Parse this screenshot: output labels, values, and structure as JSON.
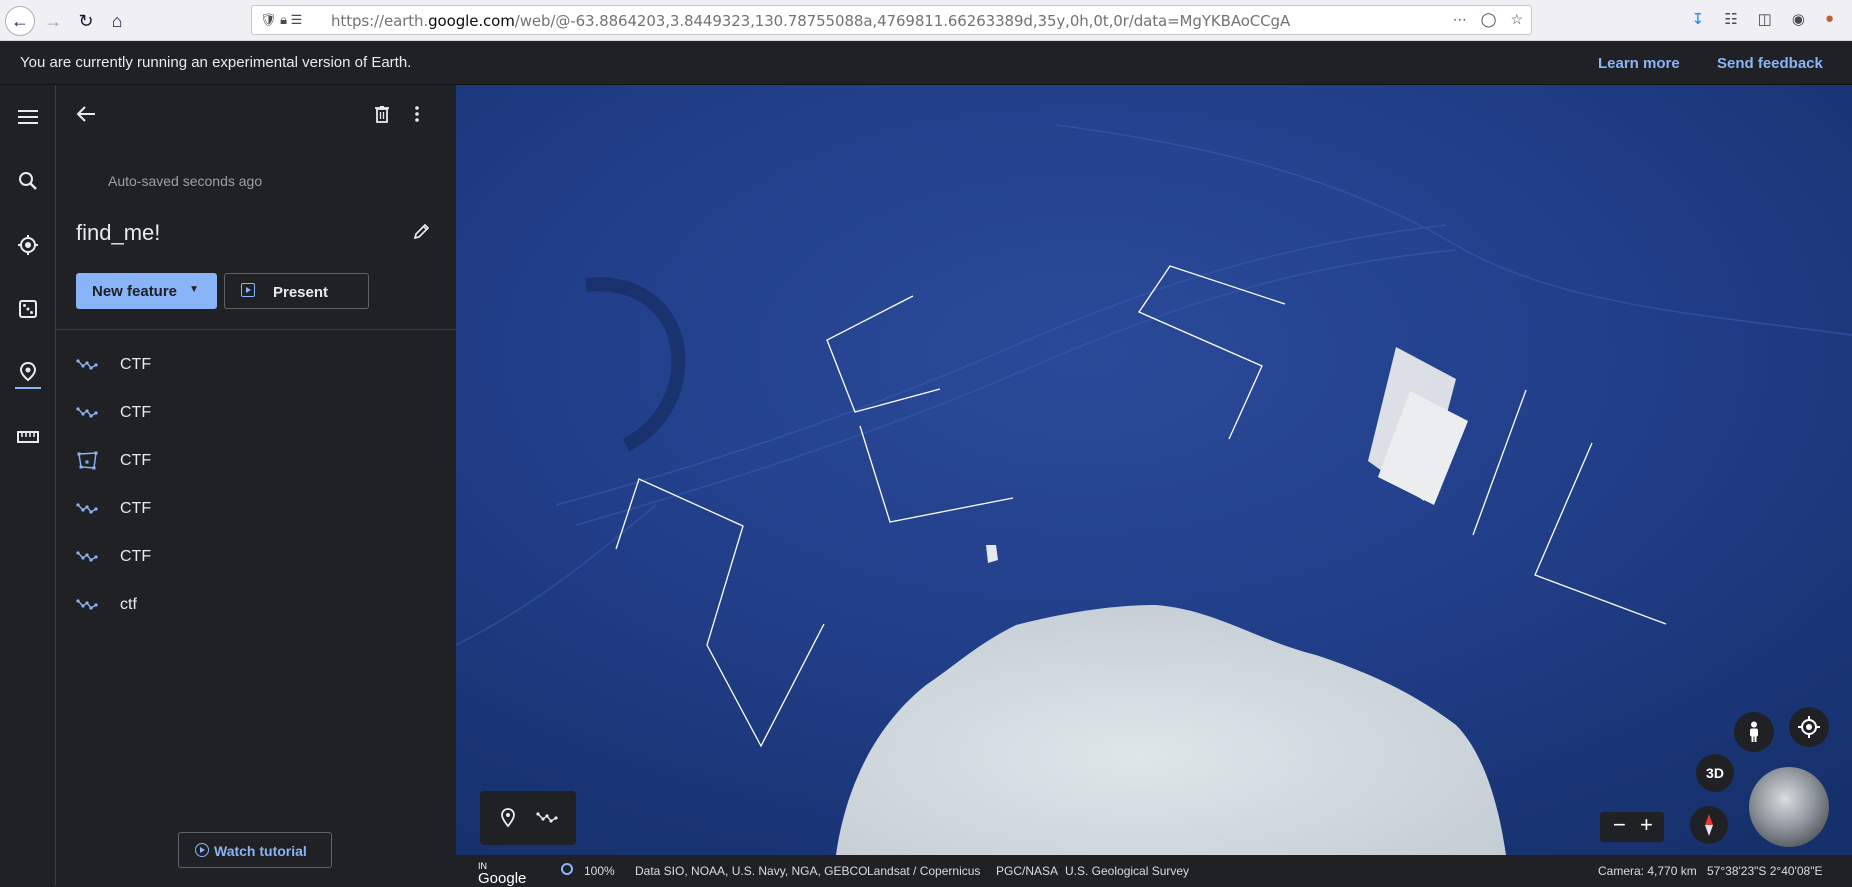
{
  "browser": {
    "url_prefix": "https://earth.",
    "url_host": "google.com",
    "url_rest": "/web/@-63.8864203,3.8449323,130.78755088a,4769811.66263389d,35y,0h,0t,0r/data=MgYKBAoCCgA"
  },
  "banner": {
    "message": "You are currently running an experimental version of Earth.",
    "learn_more": "Learn more",
    "send_feedback": "Send feedback"
  },
  "panel": {
    "autosave": "Auto-saved seconds ago",
    "title": "find_me!",
    "new_feature": "New feature",
    "present": "Present",
    "features": [
      {
        "label": "CTF",
        "icon": "line-icon"
      },
      {
        "label": "CTF",
        "icon": "line-icon"
      },
      {
        "label": "CTF",
        "icon": "polygon-icon"
      },
      {
        "label": "CTF",
        "icon": "line-icon"
      },
      {
        "label": "CTF",
        "icon": "line-icon"
      },
      {
        "label": "ctf",
        "icon": "line-icon"
      }
    ],
    "watch_tutorial": "Watch tutorial"
  },
  "map": {
    "threed_label": "3D"
  },
  "footer": {
    "logo": "Google",
    "logo_sup": "IN",
    "zoom": "100%",
    "data_credit": "Data SIO, NOAA, U.S. Navy, NGA, GEBCO",
    "landsat": "Landsat / Copernicus",
    "pgc": "PGC/NASA",
    "usgs": "U.S. Geological Survey",
    "camera": "Camera: 4,770 km",
    "coords": "57°38'23\"S 2°40'08\"E"
  },
  "colors": {
    "accent": "#8ab4f8",
    "panel_bg": "#202124",
    "ocean": "#1e3a80"
  }
}
